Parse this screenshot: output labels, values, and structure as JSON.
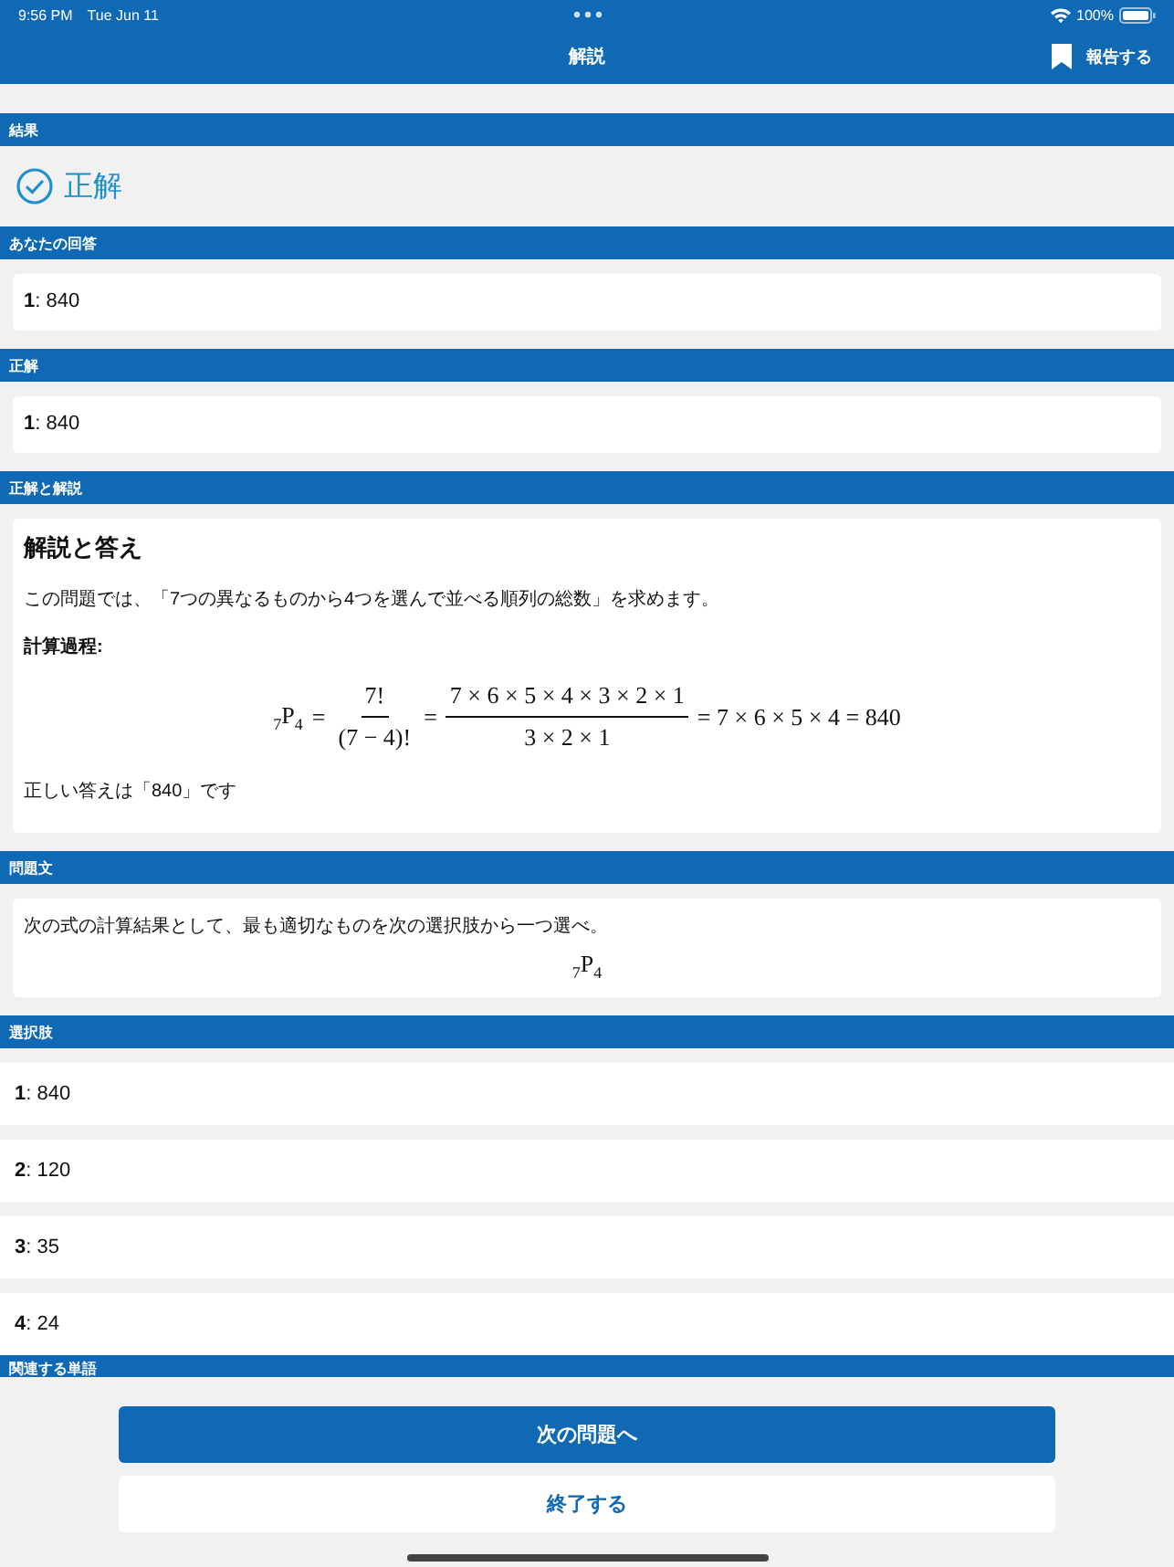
{
  "status_bar": {
    "time": "9:56 PM",
    "date": "Tue Jun 11",
    "battery": "100%"
  },
  "nav": {
    "title": "解説",
    "report_button": "報告する"
  },
  "sections": [
    {
      "kind": "result",
      "header": "結果",
      "result": "正解"
    },
    {
      "kind": "answer",
      "header": "あなたの回答",
      "text": "**1**: 840"
    },
    {
      "kind": "answer",
      "header": "正解",
      "text": "**1**: 840"
    },
    {
      "kind": "explanation",
      "header": "正解と解説",
      "title": "解説と答え",
      "intro": "この問題では、「7つの異なるものから4つを選んで並べる順列の総数」を求めます。",
      "subheading": "計算過程:",
      "formula": [
        {
          "kind": "perm",
          "pre": "7",
          "letter": "P",
          "sub": "4"
        },
        {
          "kind": "op",
          "text": "="
        },
        {
          "kind": "frac",
          "num": "7!",
          "den": "(7 − 4)!"
        },
        {
          "kind": "op",
          "text": "="
        },
        {
          "kind": "frac",
          "num": "7 × 6 × 5 × 4 × 3 × 2 × 1",
          "den": "3 × 2 × 1"
        },
        {
          "kind": "op",
          "text": "= 7 × 6 × 5 × 4 = 840"
        }
      ],
      "conclusion": "正しい答えは「840」です"
    },
    {
      "kind": "question",
      "header": "問題文",
      "text": "次の式の計算結果として、最も適切なものを次の選択肢から一つ選べ。",
      "formula": [
        {
          "kind": "perm",
          "pre": "7",
          "letter": "P",
          "sub": "4"
        }
      ]
    },
    {
      "kind": "choices",
      "header": "選択肢",
      "choices": [
        "**1**: 840",
        "**2**: 120",
        "**3**: 35",
        "**4**: 24"
      ]
    },
    {
      "kind": "clipped",
      "header": "関連する単語"
    }
  ],
  "buttons": {
    "next": "次の問題へ",
    "finish": "終了する"
  }
}
